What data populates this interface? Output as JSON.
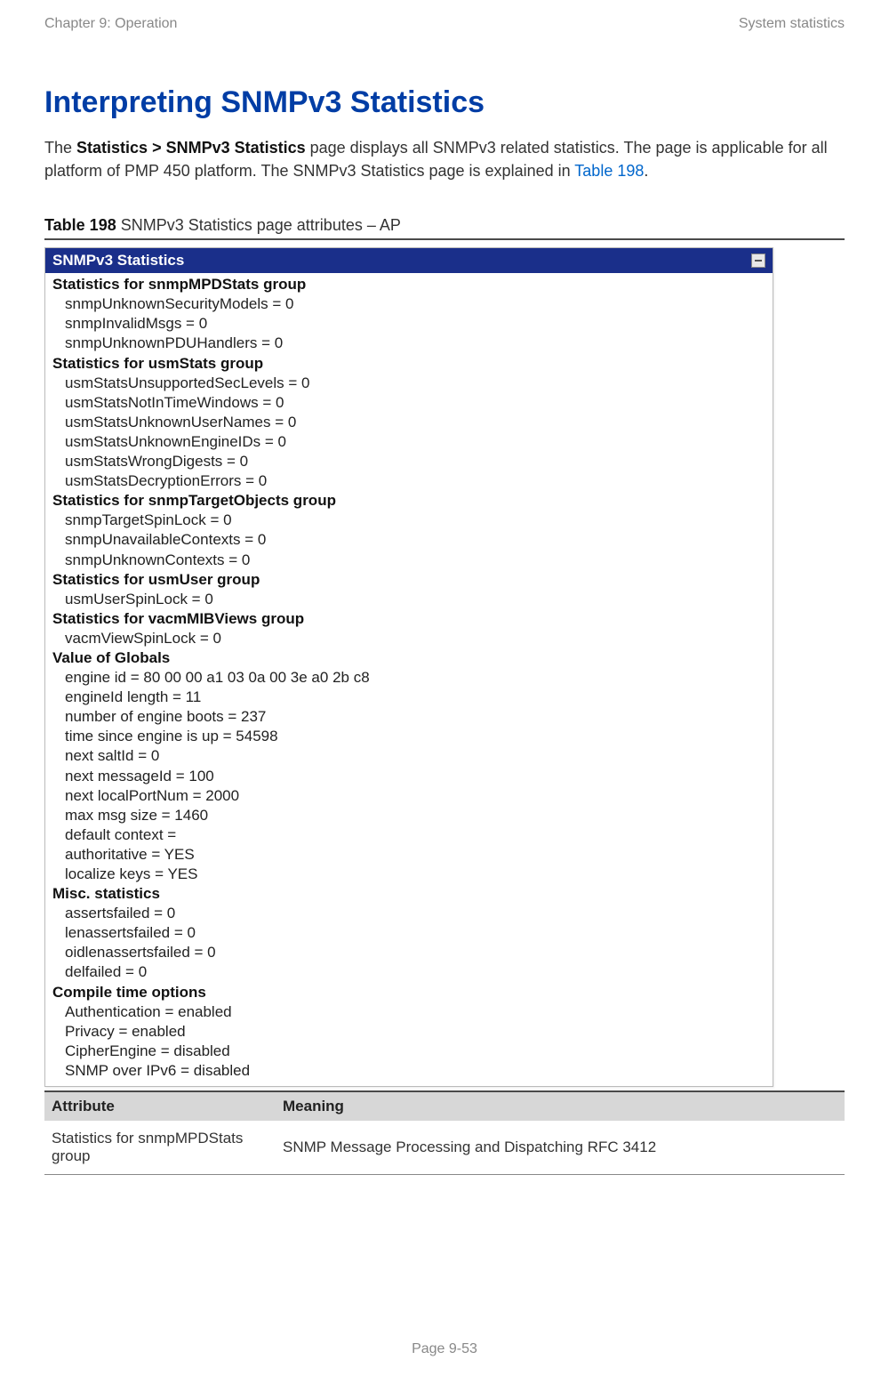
{
  "header": {
    "left": "Chapter 9:  Operation",
    "right": "System statistics"
  },
  "title": "Interpreting SNMPv3 Statistics",
  "intro": {
    "prefix": "The ",
    "bold": "Statistics > SNMPv3 Statistics",
    "mid": " page displays all SNMPv3 related statistics. The page is applicable for all platform of PMP 450 platform. The SNMPv3 Statistics page is explained in ",
    "link": "Table 198",
    "suffix": "."
  },
  "table_caption": {
    "bold": "Table 198",
    "rest": " SNMPv3 Statistics page attributes – AP"
  },
  "panel": {
    "title": "SNMPv3 Statistics",
    "groups": [
      {
        "heading": "Statistics for snmpMPDStats group",
        "lines": [
          "snmpUnknownSecurityModels = 0",
          "snmpInvalidMsgs = 0",
          "snmpUnknownPDUHandlers = 0"
        ]
      },
      {
        "heading": "Statistics for usmStats group",
        "lines": [
          "usmStatsUnsupportedSecLevels = 0",
          "usmStatsNotInTimeWindows = 0",
          "usmStatsUnknownUserNames = 0",
          "usmStatsUnknownEngineIDs = 0",
          "usmStatsWrongDigests = 0",
          "usmStatsDecryptionErrors = 0"
        ]
      },
      {
        "heading": "Statistics for snmpTargetObjects group",
        "lines": [
          "snmpTargetSpinLock = 0",
          "snmpUnavailableContexts = 0",
          "snmpUnknownContexts = 0"
        ]
      },
      {
        "heading": "Statistics for usmUser group",
        "lines": [
          "usmUserSpinLock = 0"
        ]
      },
      {
        "heading": "Statistics for vacmMIBViews group",
        "lines": [
          "vacmViewSpinLock = 0"
        ]
      },
      {
        "heading": "Value of Globals",
        "lines": [
          "engine id = 80 00 00 a1 03 0a 00 3e a0 2b c8",
          "engineId length = 11",
          "number of engine boots = 237",
          "time since engine is up = 54598",
          "next saltId = 0",
          "next messageId = 100",
          "next localPortNum = 2000",
          "max msg size = 1460",
          "default context =",
          "authoritative = YES",
          "localize keys = YES"
        ]
      },
      {
        "heading": "Misc. statistics",
        "lines": [
          "assertsfailed = 0",
          "lenassertsfailed = 0",
          "oidlenassertsfailed = 0",
          "delfailed = 0"
        ]
      },
      {
        "heading": "Compile time options",
        "lines": [
          "Authentication = enabled",
          "Privacy = enabled",
          "CipherEngine = disabled",
          "SNMP over IPv6 = disabled"
        ]
      }
    ]
  },
  "attr_table": {
    "header": {
      "col1": "Attribute",
      "col2": "Meaning"
    },
    "rows": [
      {
        "attr": "Statistics for snmpMPDStats group",
        "meaning": "SNMP Message Processing and Dispatching RFC 3412"
      }
    ]
  },
  "footer": "Page 9-53"
}
